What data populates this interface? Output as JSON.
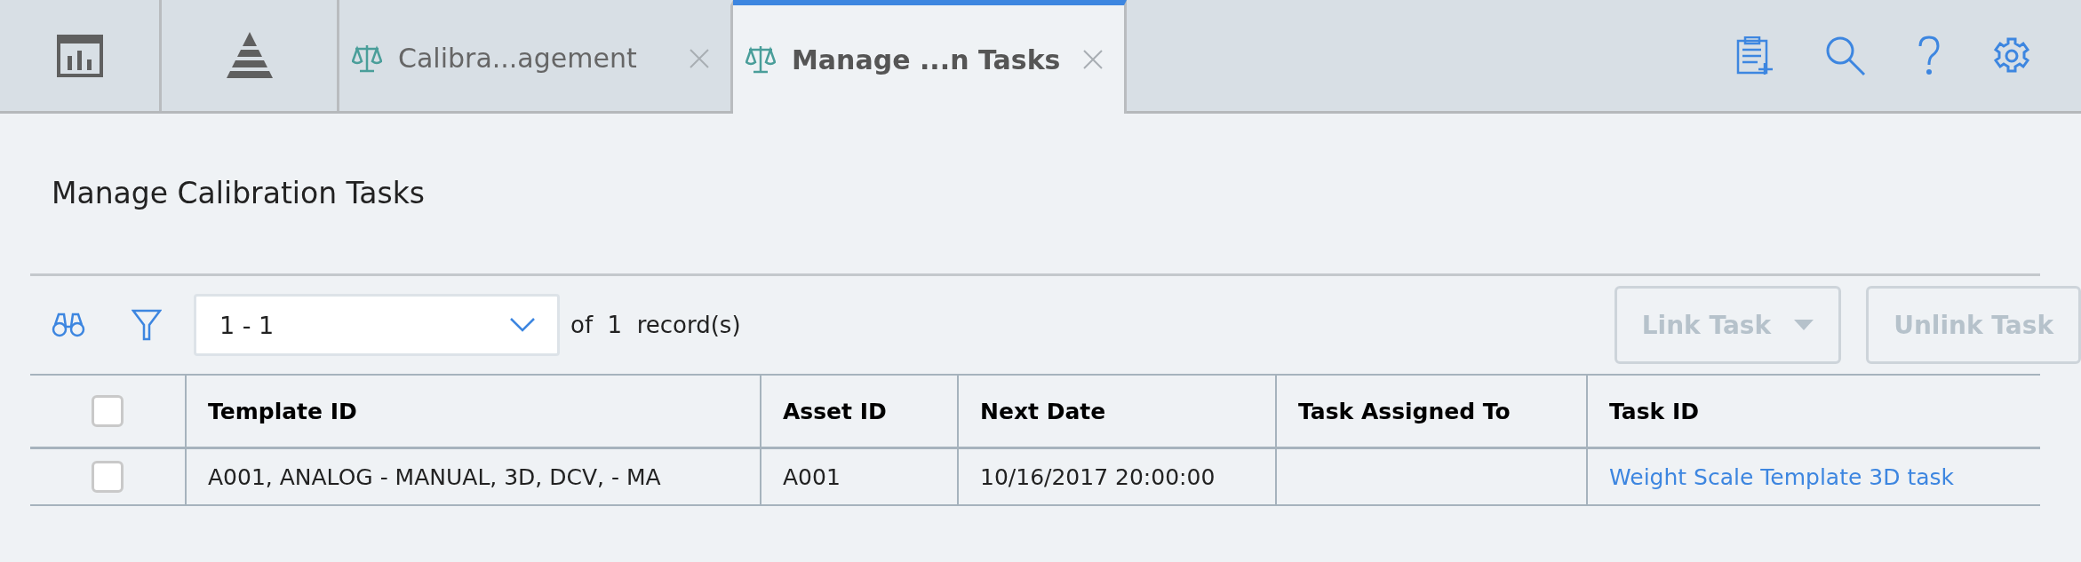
{
  "tabs": [
    {
      "label": "Calibra...agement",
      "selected": false
    },
    {
      "label": "Manage ...n Tasks",
      "selected": true
    }
  ],
  "page_title": "Manage Calibration Tasks",
  "pager": {
    "value": "1 - 1",
    "of_label": "of",
    "count": "1",
    "unit": "record(s)"
  },
  "buttons": [
    {
      "label": "Link Task",
      "kind": "dropdown",
      "disabled": true
    },
    {
      "label": "Unlink Task",
      "kind": "plain",
      "disabled": true
    }
  ],
  "table": {
    "columns": [
      "Template ID",
      "Asset ID",
      "Next Date",
      "Task Assigned To",
      "Task ID"
    ],
    "header_checked": false,
    "rows": [
      {
        "checked": false,
        "cells": [
          "A001, ANALOG - MANUAL, 3D, DCV, - MA",
          "A001",
          "10/16/2017 20:00:00",
          "",
          "Weight Scale Template 3D task"
        ]
      }
    ]
  }
}
